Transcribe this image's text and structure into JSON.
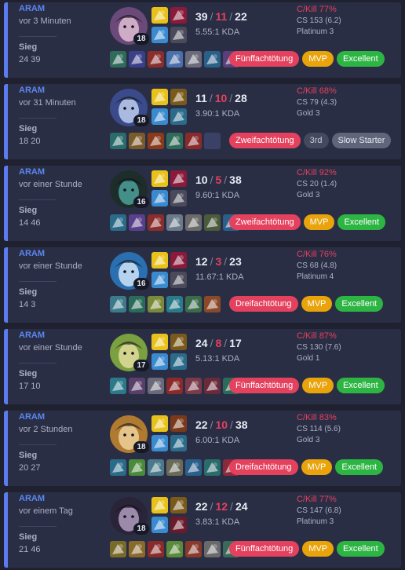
{
  "matches": [
    {
      "mode": "ARAM",
      "ago": "vor 3 Minuten",
      "result": "Sieg",
      "duration": "24 39",
      "champion_icon": "champion-portrait-icon",
      "level": "18",
      "kills": "39",
      "deaths": "11",
      "assists": "22",
      "kda": "5.55:1 KDA",
      "ckill": "C/Kill 77%",
      "cs": "CS 153 (6.2)",
      "rank": "Platinum 3",
      "colors": {
        "champ_bg": "#6b4a7a",
        "champ_fg": "#e8c4d8"
      },
      "badges": [
        {
          "text": "Fünffachtötung",
          "color": "red"
        },
        {
          "text": "MVP",
          "color": "gold"
        },
        {
          "text": "Excellent",
          "color": "green"
        }
      ]
    },
    {
      "mode": "ARAM",
      "ago": "vor 31 Minuten",
      "result": "Sieg",
      "duration": "18 20",
      "champion_icon": "champion-portrait-icon",
      "level": "18",
      "kills": "11",
      "deaths": "10",
      "assists": "28",
      "kda": "3.90:1 KDA",
      "ckill": "C/Kill 68%",
      "cs": "CS 79 (4.3)",
      "rank": "Gold 3",
      "colors": {
        "champ_bg": "#3a4a8a",
        "champ_fg": "#c7d4f4"
      },
      "badges": [
        {
          "text": "Zweifachtötung",
          "color": "red"
        },
        {
          "text": "3rd",
          "color": "dark"
        },
        {
          "text": "Slow Starter",
          "color": "gray"
        }
      ]
    },
    {
      "mode": "ARAM",
      "ago": "vor einer Stunde",
      "result": "Sieg",
      "duration": "14 46",
      "champion_icon": "champion-portrait-icon",
      "level": "16",
      "kills": "10",
      "deaths": "5",
      "assists": "38",
      "kda": "9.60:1 KDA",
      "ckill": "C/Kill 92%",
      "cs": "CS 20 (1.4)",
      "rank": "Gold 3",
      "colors": {
        "champ_bg": "#1c2d2a",
        "champ_fg": "#4fa8a0"
      },
      "badges": [
        {
          "text": "Zweifachtötung",
          "color": "red"
        },
        {
          "text": "MVP",
          "color": "gold"
        },
        {
          "text": "Excellent",
          "color": "green"
        }
      ]
    },
    {
      "mode": "ARAM",
      "ago": "vor einer Stunde",
      "result": "Sieg",
      "duration": "14 3",
      "champion_icon": "champion-portrait-icon",
      "level": "16",
      "kills": "12",
      "deaths": "3",
      "assists": "23",
      "kda": "11.67:1 KDA",
      "ckill": "C/Kill 76%",
      "cs": "CS 68 (4.8)",
      "rank": "Platinum 4",
      "colors": {
        "champ_bg": "#2a6fb0",
        "champ_fg": "#d8ecff"
      },
      "badges": [
        {
          "text": "Dreifachtötung",
          "color": "red"
        },
        {
          "text": "MVP",
          "color": "gold"
        },
        {
          "text": "Excellent",
          "color": "green"
        }
      ]
    },
    {
      "mode": "ARAM",
      "ago": "vor einer Stunde",
      "result": "Sieg",
      "duration": "17 10",
      "champion_icon": "champion-portrait-icon",
      "level": "17",
      "kills": "24",
      "deaths": "8",
      "assists": "17",
      "kda": "5.13:1 KDA",
      "ckill": "C/Kill 87%",
      "cs": "CS 130 (7.6)",
      "rank": "Gold 1",
      "colors": {
        "champ_bg": "#7aa040",
        "champ_fg": "#e8e0a0"
      },
      "badges": [
        {
          "text": "Fünffachtötung",
          "color": "red"
        },
        {
          "text": "MVP",
          "color": "gold"
        },
        {
          "text": "Excellent",
          "color": "green"
        }
      ]
    },
    {
      "mode": "ARAM",
      "ago": "vor 2 Stunden",
      "result": "Sieg",
      "duration": "20 27",
      "champion_icon": "champion-portrait-icon",
      "level": "18",
      "kills": "22",
      "deaths": "10",
      "assists": "38",
      "kda": "6.00:1 KDA",
      "ckill": "C/Kill 83%",
      "cs": "CS 114 (5.6)",
      "rank": "Gold 3",
      "colors": {
        "champ_bg": "#b07a30",
        "champ_fg": "#f3d7a0"
      },
      "badges": [
        {
          "text": "Dreifachtötung",
          "color": "red"
        },
        {
          "text": "MVP",
          "color": "gold"
        },
        {
          "text": "Excellent",
          "color": "green"
        }
      ]
    },
    {
      "mode": "ARAM",
      "ago": "vor einem Tag",
      "result": "Sieg",
      "duration": "21 46",
      "champion_icon": "champion-portrait-icon",
      "level": "18",
      "kills": "22",
      "deaths": "12",
      "assists": "24",
      "kda": "3.83:1 KDA",
      "ckill": "C/Kill 77%",
      "cs": "CS 147 (6.8)",
      "rank": "Platinum 3",
      "colors": {
        "champ_bg": "#2a2438",
        "champ_fg": "#b9a4c8"
      },
      "badges": [
        {
          "text": "Fünffachtötung",
          "color": "red"
        },
        {
          "text": "MVP",
          "color": "gold"
        },
        {
          "text": "Excellent",
          "color": "green"
        }
      ]
    }
  ],
  "colors": {
    "background": "#1f2130",
    "card": "#2a2e45",
    "win_bar": "#5b7cf0",
    "deaths": "#e4415e",
    "badge_red": "#e4415e",
    "badge_gold": "#e9a30b",
    "badge_green": "#2db544"
  },
  "icons": {
    "spells": [
      "flash-spell-icon",
      "snowball-spell-icon",
      "keystone-rune-icon",
      "secondary-rune-icon"
    ],
    "items": "item-icon"
  }
}
